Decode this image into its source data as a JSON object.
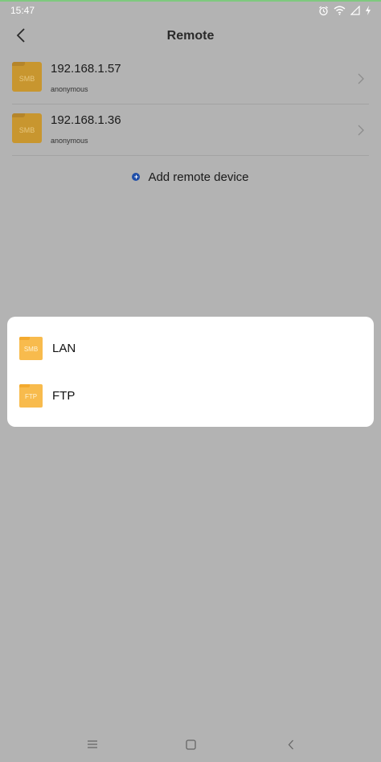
{
  "status_bar": {
    "time": "15:47",
    "icons": [
      "alarm-icon",
      "wifi-icon",
      "signal-icon",
      "charging-icon"
    ]
  },
  "header": {
    "title": "Remote",
    "back_icon": "back-arrow-icon"
  },
  "devices": [
    {
      "ip": "192.168.1.57",
      "user": "anonymous",
      "protocol_badge": "SMB"
    },
    {
      "ip": "192.168.1.36",
      "user": "anonymous",
      "protocol_badge": "SMB"
    }
  ],
  "add_remote": {
    "label": "Add remote device"
  },
  "popup": {
    "options": [
      {
        "badge": "SMB",
        "label": "LAN"
      },
      {
        "badge": "FTP",
        "label": "FTP"
      }
    ]
  },
  "colors": {
    "scrim": "#b3b3b3",
    "folder_dimmed": "#c8962f",
    "folder_active": "#f8bb4d",
    "accent_blue": "#1f4ea8"
  }
}
